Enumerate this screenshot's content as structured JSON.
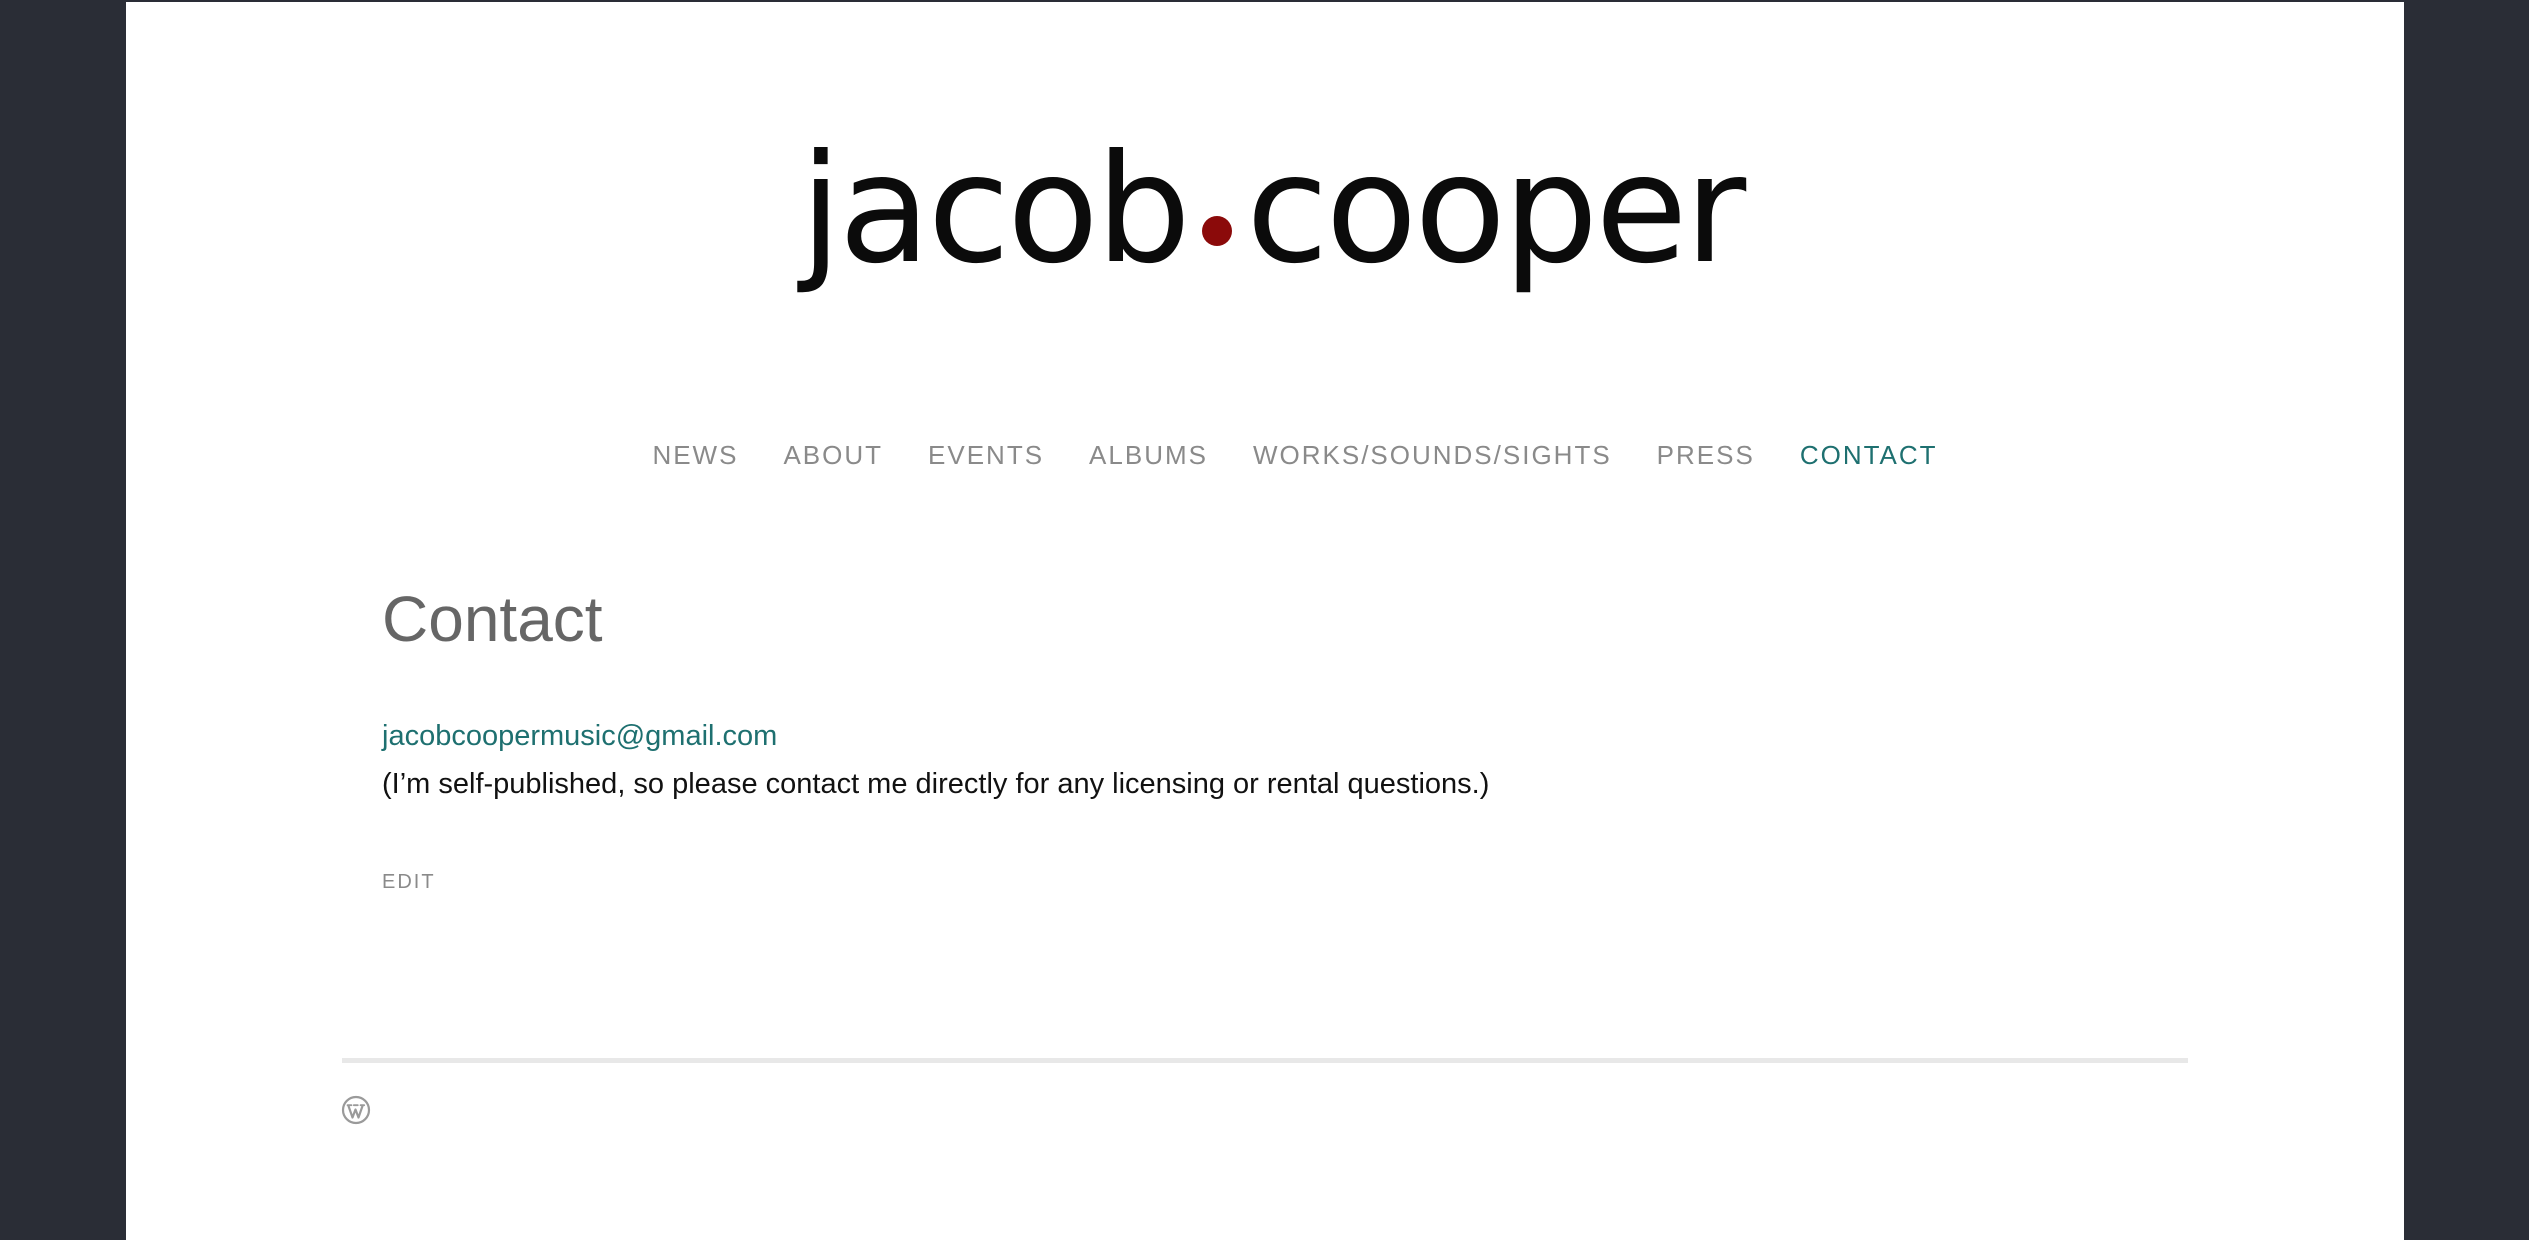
{
  "colors": {
    "background_outer": "#2a2d36",
    "page": "#ffffff",
    "accent": "#1e7070",
    "logo_dot": "#8b0a0a",
    "nav_text": "#8a8a8a"
  },
  "logo": {
    "first": "jacob",
    "second": "cooper"
  },
  "nav": {
    "items": [
      {
        "label": "NEWS"
      },
      {
        "label": "ABOUT"
      },
      {
        "label": "EVENTS"
      },
      {
        "label": "ALBUMS"
      },
      {
        "label": "WORKS/SOUNDS/SIGHTS"
      },
      {
        "label": "PRESS"
      },
      {
        "label": "CONTACT",
        "active": true
      }
    ]
  },
  "main": {
    "title": "Contact",
    "email": "jacobcoopermusic@gmail.com",
    "note": "(I’m self-published, so please contact me directly for any licensing or rental questions.)",
    "edit_label": "EDIT"
  },
  "footer": {
    "icon": "wordpress-icon"
  }
}
